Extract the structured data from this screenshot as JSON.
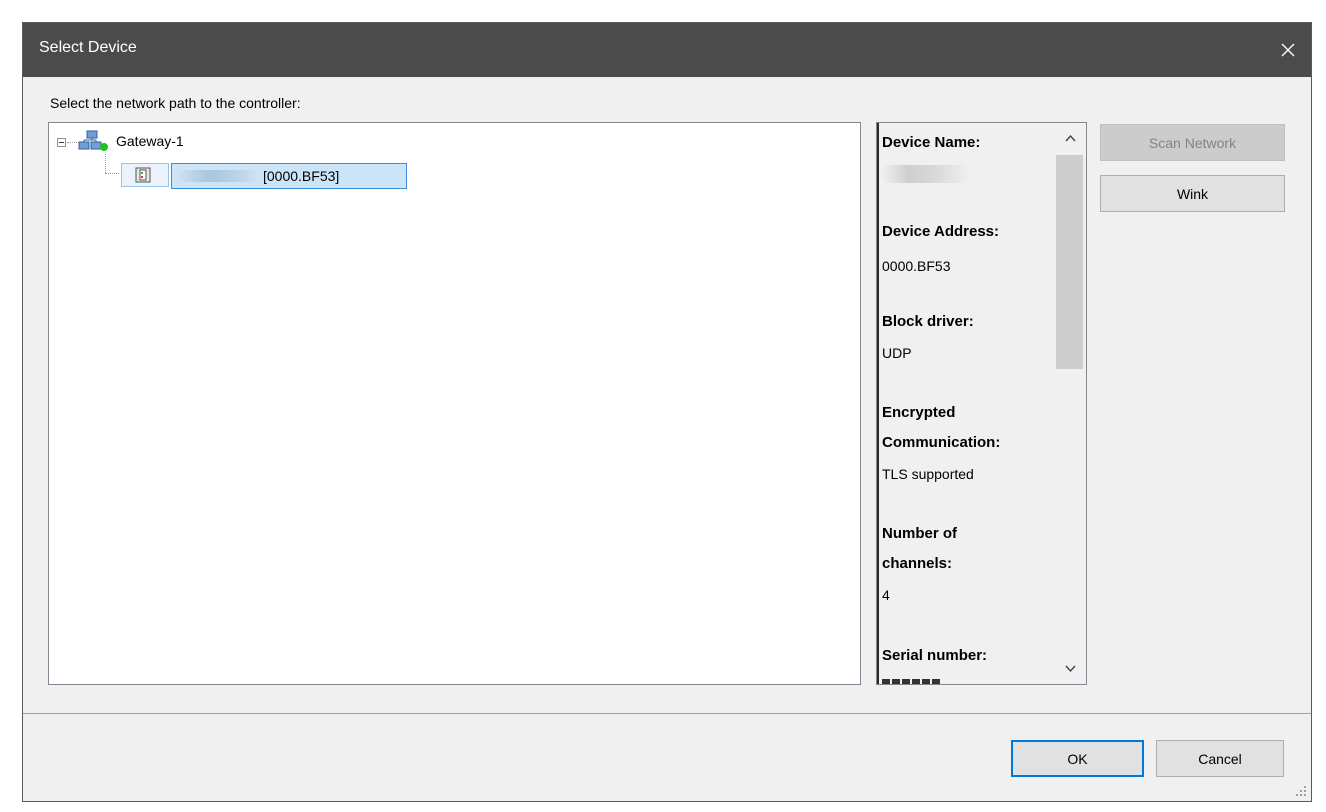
{
  "window": {
    "title": "Select Device"
  },
  "instruction": "Select the network path to the controller:",
  "tree": {
    "gateway_label": "Gateway-1",
    "device_address": "[0000.BF53]"
  },
  "info": {
    "device_name_label": "Device Name:",
    "device_address_label": "Device Address:",
    "device_address_value": "0000.BF53",
    "block_driver_label": "Block driver:",
    "block_driver_value": "UDP",
    "encrypted_label_line1": "Encrypted",
    "encrypted_label_line2": "Communication:",
    "encrypted_value": "TLS supported",
    "channels_label_line1": "Number of",
    "channels_label_line2": "channels:",
    "channels_value": "4",
    "serial_label": "Serial number:"
  },
  "buttons": {
    "scan_network": "Scan Network",
    "wink": "Wink",
    "ok": "OK",
    "cancel": "Cancel"
  },
  "icons": {
    "close": "close-icon",
    "gateway": "network-gateway-icon",
    "status": "status-online-icon",
    "device": "controller-device-icon"
  },
  "colors": {
    "titlebar": "#4b4b4b",
    "selection": "#cce4f7",
    "selection_border": "#3b8ed6",
    "default_button_border": "#0078d7",
    "status_online": "#1fc11f"
  }
}
